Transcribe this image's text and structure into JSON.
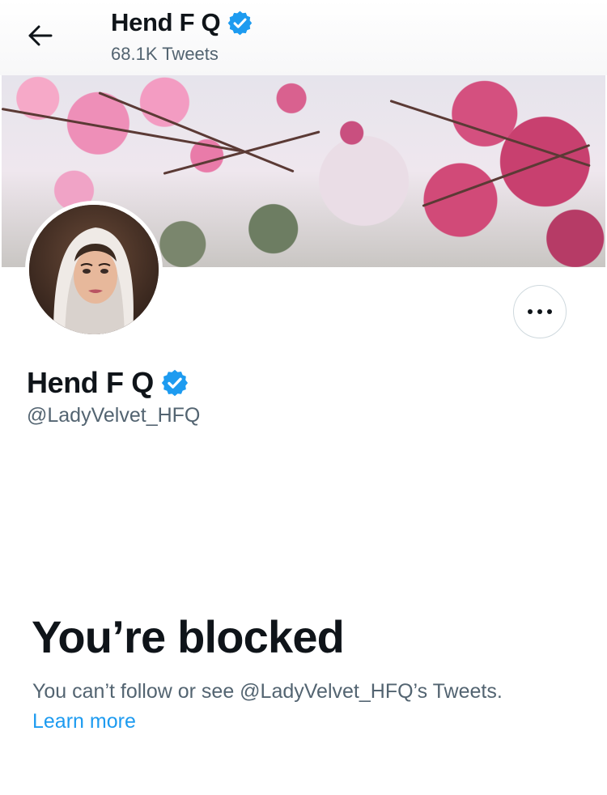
{
  "header": {
    "back_icon": "arrow-left-icon",
    "name": "Hend F Q",
    "tweet_count": "68.1K Tweets",
    "verified_icon": "verified-badge-icon"
  },
  "profile": {
    "name": "Hend F Q",
    "handle": "@LadyVelvet_HFQ",
    "verified_icon": "verified-badge-icon",
    "avatar": "profile-photo",
    "banner": "cherry-blossom-banner",
    "more_icon": "more-horizontal-icon"
  },
  "blocked": {
    "title": "You’re blocked",
    "description": "You can’t follow or see @LadyVelvet_HFQ’s Tweets.",
    "learn_more": "Learn more"
  },
  "colors": {
    "text_primary": "#0f1419",
    "text_secondary": "#536471",
    "link": "#1d9bf0",
    "verified": "#1d9bf0",
    "border": "#cfd9de"
  }
}
